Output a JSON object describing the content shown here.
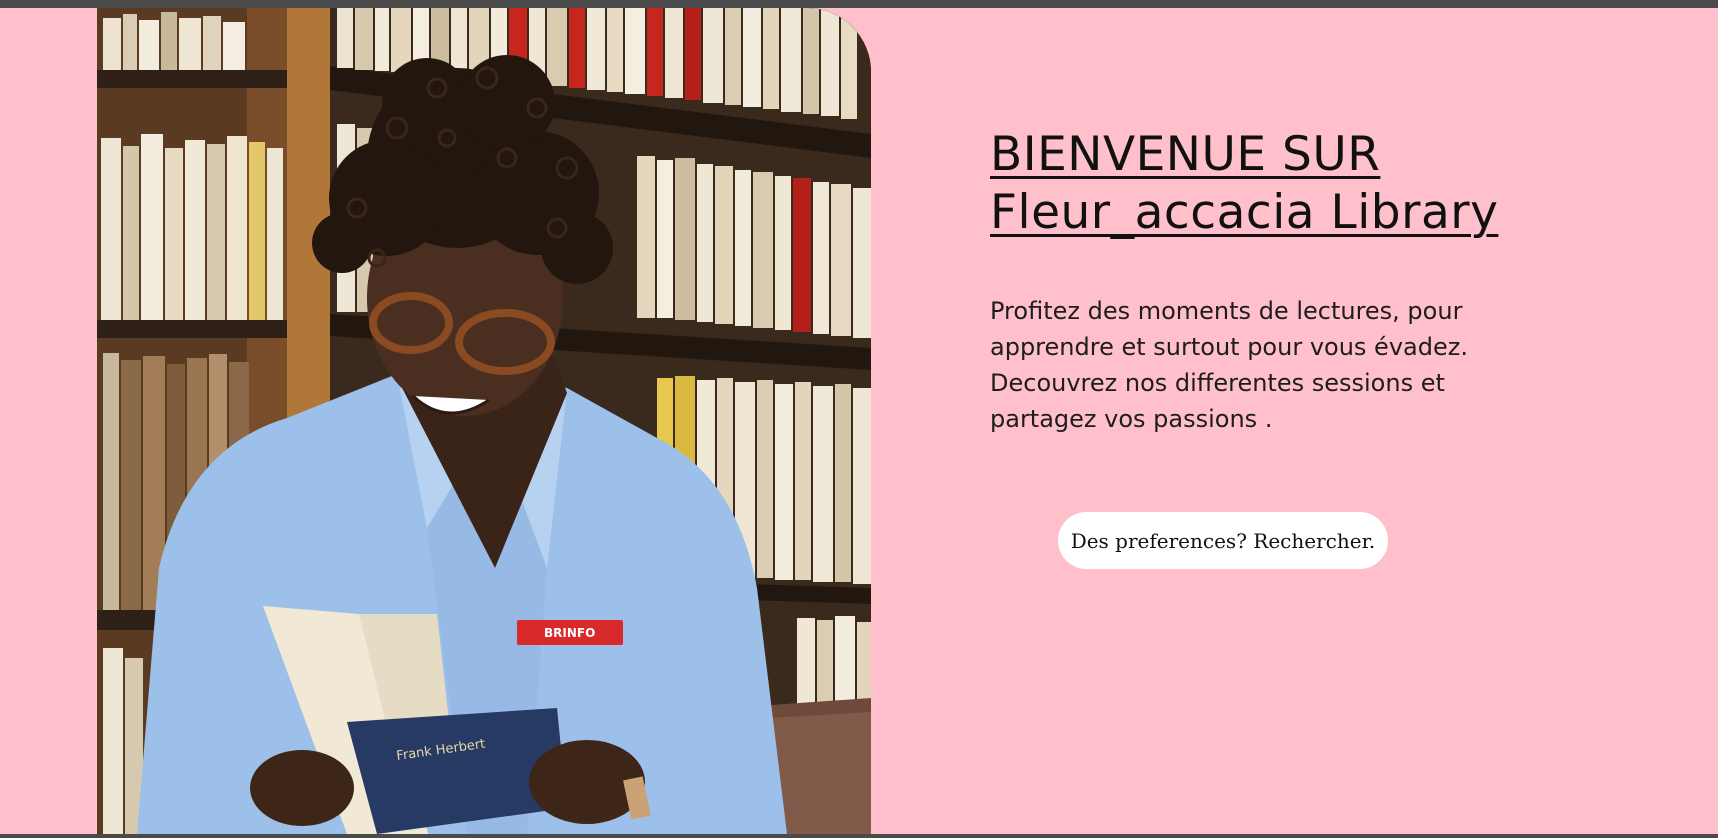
{
  "hero": {
    "title_line1": "BIENVENUE SUR",
    "title_line2": "Fleur_accacia Library",
    "description_lines": [
      "Profitez des moments de lectures, pour",
      "apprendre et surtout pour vous évadez.",
      "Decouvrez nos differentes sessions et",
      "partagez vos passions ."
    ],
    "search_button_label": "Des preferences? Rechercher."
  },
  "photo": {
    "shirt_badge_text": "BRINFO",
    "book_cover_text": "Frank Herbert"
  },
  "colors": {
    "page_background": "#ffc0cb",
    "frame_background": "#4a4a4a",
    "button_background": "#ffffff",
    "text": "#111111",
    "shirt": "#9dc0ea",
    "badge": "#d82a2a"
  }
}
